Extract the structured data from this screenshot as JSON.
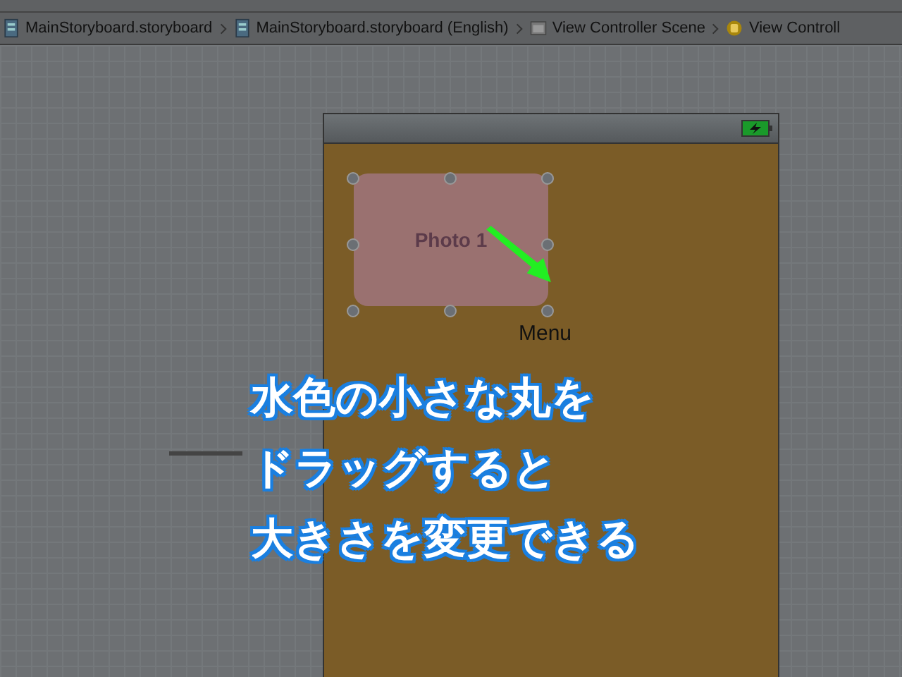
{
  "breadcrumbs": [
    {
      "kind": "storyboard",
      "label": "MainStoryboard.storyboard"
    },
    {
      "kind": "storyboard",
      "label": "MainStoryboard.storyboard (English)"
    },
    {
      "kind": "scene",
      "label": "View Controller Scene"
    },
    {
      "kind": "controller",
      "label": "View Controll"
    }
  ],
  "phone": {
    "button": {
      "label": "Photo 1"
    },
    "menu_label": "Menu"
  },
  "caption": {
    "lines": [
      "水色の小さな丸を",
      "ドラッグすると",
      "大きさを変更できる"
    ]
  }
}
